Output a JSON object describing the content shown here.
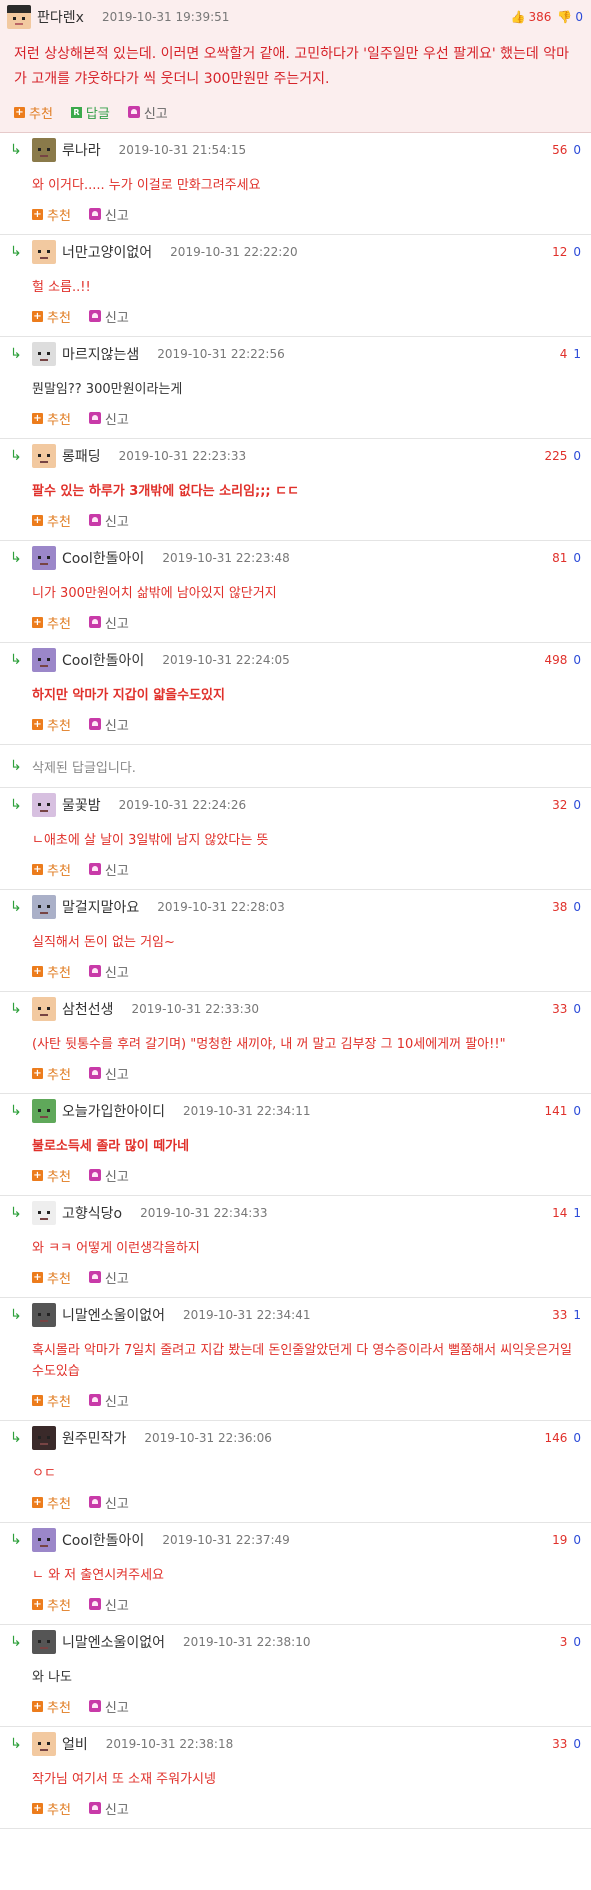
{
  "post": {
    "nickname": "판다렌x",
    "datetime": "2019-10-31 19:39:51",
    "up": "386",
    "down": "0",
    "body": "저런 상상해본적 있는데. 이러면 오싹할거 같애. 고민하다가 '일주일만 우선 팔게요' 했는데 악마가 고개를 갸웃하다가 씩 웃더니 300만원만 주는거지.",
    "recommend_label": "추천",
    "reply_label": "답글",
    "report_label": "신고"
  },
  "comments": [
    {
      "nickname": "루나라",
      "datetime": "2019-10-31 21:54:15",
      "up": "56",
      "down": "0",
      "body": "와 이거다..... 누가 이걸로 만화그려주세요",
      "recommend_label": "추천",
      "report_label": "신고"
    },
    {
      "nickname": "너만고양이없어",
      "datetime": "2019-10-31 22:22:20",
      "up": "12",
      "down": "0",
      "body": "헐 소름..!!",
      "recommend_label": "추천",
      "report_label": "신고"
    },
    {
      "nickname": "마르지않는샘",
      "datetime": "2019-10-31 22:22:56",
      "up": "4",
      "down": "1",
      "body": "뭔말임?? 300만원이라는게",
      "recommend_label": "추천",
      "report_label": "신고"
    },
    {
      "nickname": "롱패딩",
      "datetime": "2019-10-31 22:23:33",
      "up": "225",
      "down": "0",
      "body": "팔수 있는 하루가 3개밖에 없다는 소리임;;; ㄷㄷ",
      "recommend_label": "추천",
      "report_label": "신고"
    },
    {
      "nickname": "Cool한돌아이",
      "datetime": "2019-10-31 22:23:48",
      "up": "81",
      "down": "0",
      "body": "니가 300만원어치 삶밖에 남아있지 않단거지",
      "recommend_label": "추천",
      "report_label": "신고"
    },
    {
      "nickname": "Cool한돌아이",
      "datetime": "2019-10-31 22:24:05",
      "up": "498",
      "down": "0",
      "body": "하지만 악마가 지갑이 얇을수도있지",
      "recommend_label": "추천",
      "report_label": "신고"
    },
    {
      "nickname": "물꽃밤",
      "datetime": "2019-10-31 22:24:26",
      "up": "32",
      "down": "0",
      "body": "ㄴ애초에 살 날이 3일밖에 남지 않았다는 뜻",
      "recommend_label": "추천",
      "report_label": "신고"
    },
    {
      "nickname": "말걸지말아요",
      "datetime": "2019-10-31 22:28:03",
      "up": "38",
      "down": "0",
      "body": "실직해서 돈이 없는 거임~",
      "recommend_label": "추천",
      "report_label": "신고"
    },
    {
      "nickname": "삼천선생",
      "datetime": "2019-10-31 22:33:30",
      "up": "33",
      "down": "0",
      "body": "(사탄 뒷통수를 후려 갈기며) \"멍청한 새끼야, 내 꺼 말고 김부장 그 10세에게꺼 팔아!!\"",
      "recommend_label": "추천",
      "report_label": "신고"
    },
    {
      "nickname": "오늘가입한아이디",
      "datetime": "2019-10-31 22:34:11",
      "up": "141",
      "down": "0",
      "body": "불로소득세 졸라 많이 떼가네",
      "recommend_label": "추천",
      "report_label": "신고"
    },
    {
      "nickname": "고향식당o",
      "datetime": "2019-10-31 22:34:33",
      "up": "14",
      "down": "1",
      "body": "와 ㅋㅋ 어떻게 이런생각을하지",
      "recommend_label": "추천",
      "report_label": "신고"
    },
    {
      "nickname": "니말엔소울이없어",
      "datetime": "2019-10-31 22:34:41",
      "up": "33",
      "down": "1",
      "body": "혹시몰라 악마가 7일치 줄려고 지갑 봤는데 돈인줄알았던게 다 영수증이라서 뻘쭘해서 씨익웃은거일수도있습",
      "recommend_label": "추천",
      "report_label": "신고"
    },
    {
      "nickname": "원주민작가",
      "datetime": "2019-10-31 22:36:06",
      "up": "146",
      "down": "0",
      "body": "ㅇㄷ",
      "recommend_label": "추천",
      "report_label": "신고"
    },
    {
      "nickname": "Cool한돌아이",
      "datetime": "2019-10-31 22:37:49",
      "up": "19",
      "down": "0",
      "body": "ㄴ 와 저 출연시켜주세요",
      "recommend_label": "추천",
      "report_label": "신고"
    },
    {
      "nickname": "니말엔소울이없어",
      "datetime": "2019-10-31 22:38:10",
      "up": "3",
      "down": "0",
      "body": "와 나도",
      "recommend_label": "추천",
      "report_label": "신고"
    },
    {
      "nickname": "얼비",
      "datetime": "2019-10-31 22:38:18",
      "up": "33",
      "down": "0",
      "body": "작가님 여기서 또 소재 주워가시넹",
      "recommend_label": "추천",
      "report_label": "신고"
    }
  ],
  "deleted_text": "삭제된 답글입니다.",
  "colors": {
    "up": "#e0302a",
    "down": "#2c4bd8",
    "recommend": "#ec7c1c",
    "reply": "#3ba94b",
    "report": "#c83aa8",
    "arrow": "#2ea03b"
  }
}
